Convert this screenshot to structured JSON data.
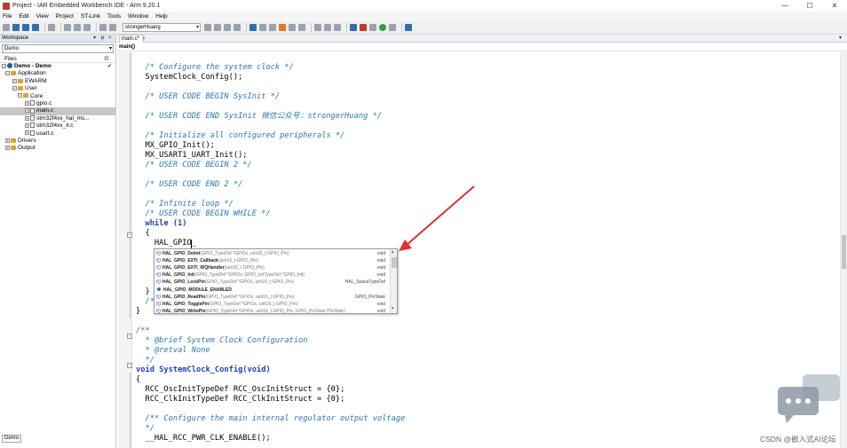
{
  "window": {
    "title": "Project - IAR Embedded Workbench IDE - Arm 9.20.1",
    "controls": [
      "—",
      "☐",
      "✕"
    ]
  },
  "menu": [
    "File",
    "Edit",
    "View",
    "Project",
    "ST-Link",
    "Tools",
    "Window",
    "Help"
  ],
  "toolbar": {
    "search_value": "strongerHuang"
  },
  "workspace": {
    "header": "Workspace",
    "controls": [
      "▾",
      "ᵽ",
      "×"
    ],
    "config": "Demo",
    "files_label": "Files",
    "tree": [
      {
        "label": "Demo - Demo",
        "type": "project",
        "exp": "−"
      },
      {
        "label": "Application",
        "type": "folder",
        "exp": "−"
      },
      {
        "label": "EWARM",
        "type": "folder",
        "exp": "+"
      },
      {
        "label": "User",
        "type": "folder",
        "exp": "−"
      },
      {
        "label": "Core",
        "type": "folder",
        "exp": "−"
      },
      {
        "label": "gpio.c",
        "type": "file",
        "exp": "+"
      },
      {
        "label": "main.c",
        "type": "file",
        "exp": "+"
      },
      {
        "label": "stm32f4xx_hal_ms...",
        "type": "file",
        "exp": "+"
      },
      {
        "label": "stm32f4xx_it.c",
        "type": "file",
        "exp": "+"
      },
      {
        "label": "usart.c",
        "type": "file",
        "exp": "+"
      },
      {
        "label": "Drivers",
        "type": "folder",
        "exp": "+"
      },
      {
        "label": "Output",
        "type": "folder",
        "exp": "+"
      }
    ],
    "bottom_tab": "Demo"
  },
  "editor": {
    "tab_label": "main.c",
    "tab_modified": "*",
    "function_bar": "main()",
    "code": [
      {
        "text": "  /* Configure the system clock */",
        "cls": "cm"
      },
      {
        "text": "  SystemClock_Config();",
        "cls": ""
      },
      {
        "text": "",
        "cls": ""
      },
      {
        "text": "  /* USER CODE BEGIN SysInit */",
        "cls": "cm"
      },
      {
        "text": "",
        "cls": ""
      },
      {
        "text": "  /* USER CODE END SysInit 微信公众号：strongerHuang */",
        "cls": "cm"
      },
      {
        "text": "",
        "cls": ""
      },
      {
        "text": "  /* Initialize all configured peripherals */",
        "cls": "cm"
      },
      {
        "text": "  MX_GPIO_Init();",
        "cls": ""
      },
      {
        "text": "  MX_USART1_UART_Init();",
        "cls": ""
      },
      {
        "text": "  /* USER CODE BEGIN 2 */",
        "cls": "cm"
      },
      {
        "text": "",
        "cls": ""
      },
      {
        "text": "  /* USER CODE END 2 */",
        "cls": "cm"
      },
      {
        "text": "",
        "cls": ""
      },
      {
        "text": "  /* Infinite loop */",
        "cls": "cm"
      },
      {
        "text": "  /* USER CODE BEGIN WHILE */",
        "cls": "cm"
      },
      {
        "text": "  while (1)",
        "cls": "kw"
      },
      {
        "text": "  {",
        "cls": ""
      },
      {
        "text": "    HAL_GPIO_",
        "cls": ""
      },
      {
        "text": "",
        "cls": ""
      },
      {
        "text": "",
        "cls": ""
      },
      {
        "text": "",
        "cls": ""
      },
      {
        "text": "",
        "cls": ""
      },
      {
        "text": "  }",
        "cls": ""
      },
      {
        "text": "  /*",
        "cls": "cm"
      },
      {
        "text": "}",
        "cls": ""
      },
      {
        "text": "",
        "cls": ""
      },
      {
        "text": "/**",
        "cls": "cm"
      },
      {
        "text": "  * @brief System Clock Configuration",
        "cls": "cm"
      },
      {
        "text": "  * @retval None",
        "cls": "cm"
      },
      {
        "text": "  */",
        "cls": "cm"
      },
      {
        "text": "void SystemClock_Config(void)",
        "cls": "kw"
      },
      {
        "text": "{",
        "cls": ""
      },
      {
        "text": "  RCC_OscInitTypeDef RCC_OscInitStruct = {0};",
        "cls": ""
      },
      {
        "text": "  RCC_ClkInitTypeDef RCC_ClkInitStruct = {0};",
        "cls": ""
      },
      {
        "text": "",
        "cls": ""
      },
      {
        "text": "  /** Configure the main internal regulator output voltage",
        "cls": "cm"
      },
      {
        "text": "  */",
        "cls": "cm"
      },
      {
        "text": "  __HAL_RCC_PWR_CLK_ENABLE();",
        "cls": ""
      }
    ]
  },
  "autocomplete": {
    "items": [
      {
        "icon": "fx",
        "name": "HAL_GPIO_DeInit",
        "sig": "(GPIO_TypeDef *GPIOx, uint32_t GPIO_Pin)",
        "ret": "void"
      },
      {
        "icon": "fx",
        "name": "HAL_GPIO_EXTI_Callback",
        "sig": "(uint16_t GPIO_Pin)",
        "ret": "void"
      },
      {
        "icon": "fx",
        "name": "HAL_GPIO_EXTI_IRQHandler",
        "sig": "(uint16_t GPIO_Pin)",
        "ret": "void"
      },
      {
        "icon": "fx",
        "name": "HAL_GPIO_Init",
        "sig": "(GPIO_TypeDef *GPIOx, GPIO_InitTypeDef *GPIO_Init)",
        "ret": "void"
      },
      {
        "icon": "fx",
        "name": "HAL_GPIO_LockPin",
        "sig": "(GPIO_TypeDef *GPIOx, uint16_t GPIO_Pin)",
        "ret": "HAL_StatusTypeDef"
      },
      {
        "icon": "dot",
        "name": "HAL_GPIO_MODULE_ENABLED",
        "sig": "",
        "ret": ""
      },
      {
        "icon": "fx",
        "name": "HAL_GPIO_ReadPin",
        "sig": "(GPIO_TypeDef *GPIOx, uint16_t GPIO_Pin)",
        "ret": "GPIO_PinState"
      },
      {
        "icon": "fx",
        "name": "HAL_GPIO_TogglePin",
        "sig": "(GPIO_TypeDef *GPIOx, uint16_t GPIO_Pin)",
        "ret": "void"
      },
      {
        "icon": "fx",
        "name": "HAL_GPIO_WritePin",
        "sig": "(GPIO_TypeDef *GPIOx, uint16_t GPIO_Pin, GPIO_PinState PinState)",
        "ret": "void"
      }
    ]
  },
  "watermark": "CSDN @嵌入式AI论坛",
  "colors": {
    "arrow": "#e03030",
    "comment": "#2d77b8",
    "keyword": "#1c3fb3"
  }
}
